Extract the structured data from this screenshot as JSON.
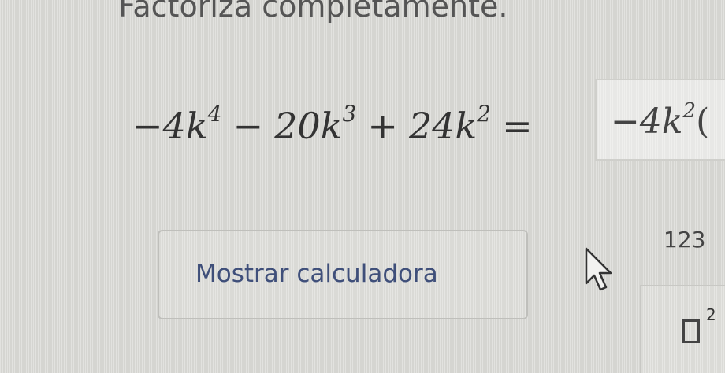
{
  "instruction": {
    "text": "Factoriza completamente."
  },
  "equation": {
    "t1_coef": "−4",
    "var": "k",
    "t1_exp": "4",
    "op1": "−",
    "t2_coef": "20",
    "t2_exp": "3",
    "op2": "+",
    "t3_coef": "24",
    "t3_exp": "2",
    "eq": "="
  },
  "answer": {
    "coef": "−4",
    "var": "k",
    "exp": "2",
    "paren": "("
  },
  "calculator": {
    "label": "Mostrar calculadora"
  },
  "keypad": {
    "toggle_label": "123",
    "square_exp": "2"
  },
  "colors": {
    "button_text": "#3f4f7a",
    "background": "#dcdcd8"
  }
}
